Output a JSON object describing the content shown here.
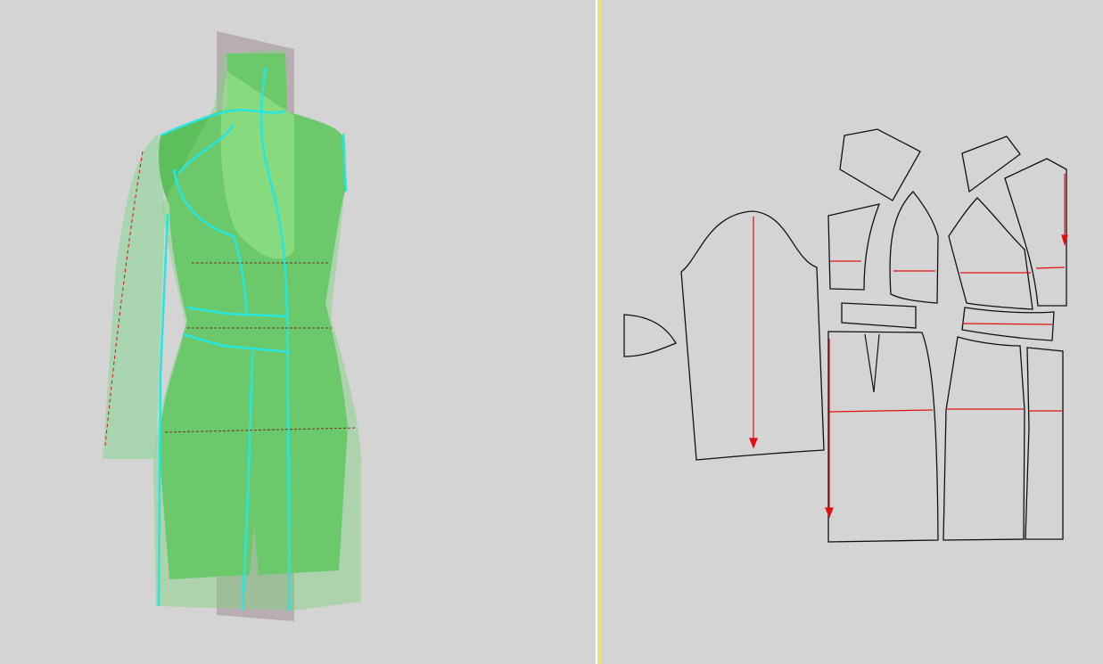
{
  "colors": {
    "background": "#d4d4d4",
    "divider": "#f2f21a",
    "body": "#5cbf5c",
    "seam": "#26e6e0",
    "grainline": "#e01010",
    "pattern_outline": "#111111"
  },
  "views": {
    "left": "3d-avatar-view",
    "right": "2d-pattern-view"
  }
}
